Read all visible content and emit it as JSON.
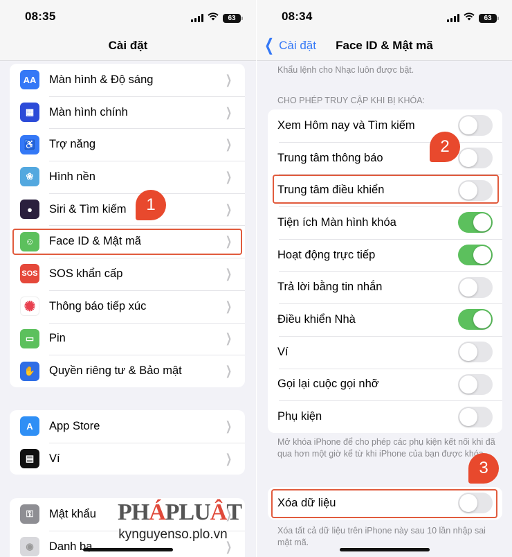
{
  "left": {
    "status": {
      "time": "08:35",
      "battery": "63"
    },
    "nav_title": "Cài đặt",
    "groups": [
      [
        {
          "label": "Màn hình & Độ sáng",
          "icon": "text-size-icon",
          "glyph": "AA",
          "color": "#3478f6"
        },
        {
          "label": "Màn hình chính",
          "icon": "home-screen-icon",
          "glyph": "▦",
          "color": "#2c4bd8"
        },
        {
          "label": "Trợ năng",
          "icon": "accessibility-icon",
          "glyph": "♿",
          "color": "#3478f6"
        },
        {
          "label": "Hình nền",
          "icon": "wallpaper-icon",
          "glyph": "❀",
          "color": "#53a8df"
        },
        {
          "label": "Siri & Tìm kiếm",
          "icon": "siri-icon",
          "glyph": "●",
          "color": "#2a1f3d"
        },
        {
          "label": "Face ID & Mật mã",
          "icon": "face-id-icon",
          "glyph": "☺",
          "color": "#5cc05d"
        },
        {
          "label": "SOS khẩn cấp",
          "icon": "sos-icon",
          "glyph": "SOS",
          "color": "#e5483a"
        },
        {
          "label": "Thông báo tiếp xúc",
          "icon": "exposure-notification-icon",
          "glyph": "✺",
          "color": "#ffffff"
        },
        {
          "label": "Pin",
          "icon": "battery-icon",
          "glyph": "▭",
          "color": "#5cc05d"
        },
        {
          "label": "Quyền riêng tư & Bảo mật",
          "icon": "privacy-hand-icon",
          "glyph": "✋",
          "color": "#2f6ee6"
        }
      ],
      [
        {
          "label": "App Store",
          "icon": "app-store-icon",
          "glyph": "A",
          "color": "#2f8ff5"
        },
        {
          "label": "Ví",
          "icon": "wallet-icon",
          "glyph": "▤",
          "color": "#111111"
        }
      ],
      [
        {
          "label": "Mật khẩu",
          "icon": "key-icon",
          "glyph": "⚿",
          "color": "#8e8e93"
        },
        {
          "label": "Danh bạ",
          "icon": "contacts-icon",
          "glyph": "◉",
          "color": "#d8d8dc"
        }
      ]
    ],
    "callout": "1"
  },
  "right": {
    "status": {
      "time": "08:34",
      "battery": "63"
    },
    "back_label": "Cài đặt",
    "nav_title": "Face ID & Mật mã",
    "top_note": "Khẩu lệnh cho Nhạc luôn được bật.",
    "section_header": "CHO PHÉP TRUY CẬP KHI BỊ KHÓA:",
    "toggles": [
      {
        "label": "Xem Hôm nay và Tìm kiếm",
        "on": false
      },
      {
        "label": "Trung tâm thông báo",
        "on": false
      },
      {
        "label": "Trung tâm điều khiển",
        "on": false
      },
      {
        "label": "Tiện ích Màn hình khóa",
        "on": true
      },
      {
        "label": "Hoạt động trực tiếp",
        "on": true
      },
      {
        "label": "Trả lời bằng tin nhắn",
        "on": false
      },
      {
        "label": "Điều khiển Nhà",
        "on": true
      },
      {
        "label": "Ví",
        "on": false
      },
      {
        "label": "Gọi lại cuộc gọi nhỡ",
        "on": false
      },
      {
        "label": "Phụ kiện",
        "on": false
      }
    ],
    "accessories_note": "Mở khóa iPhone để cho phép các phụ kiện kết nối khi đã qua hơn một giờ kể từ khi iPhone của bạn được khóa.",
    "erase": {
      "label": "Xóa dữ liệu",
      "on": false
    },
    "erase_note": "Xóa tất cả dữ liệu trên iPhone này sau 10 lần nhập sai mật mã.",
    "callouts": [
      "2",
      "3"
    ]
  },
  "watermark": {
    "brand_pre": "PH",
    "brand_a1": "Á",
    "brand_mid": "PLU",
    "brand_a2": "Â",
    "brand_post": "T",
    "site": "kynguyenso.plo.vn"
  },
  "colors": {
    "accent": "#3478f6",
    "toggle_on": "#5cc05d",
    "annotation": "#e8492d"
  }
}
